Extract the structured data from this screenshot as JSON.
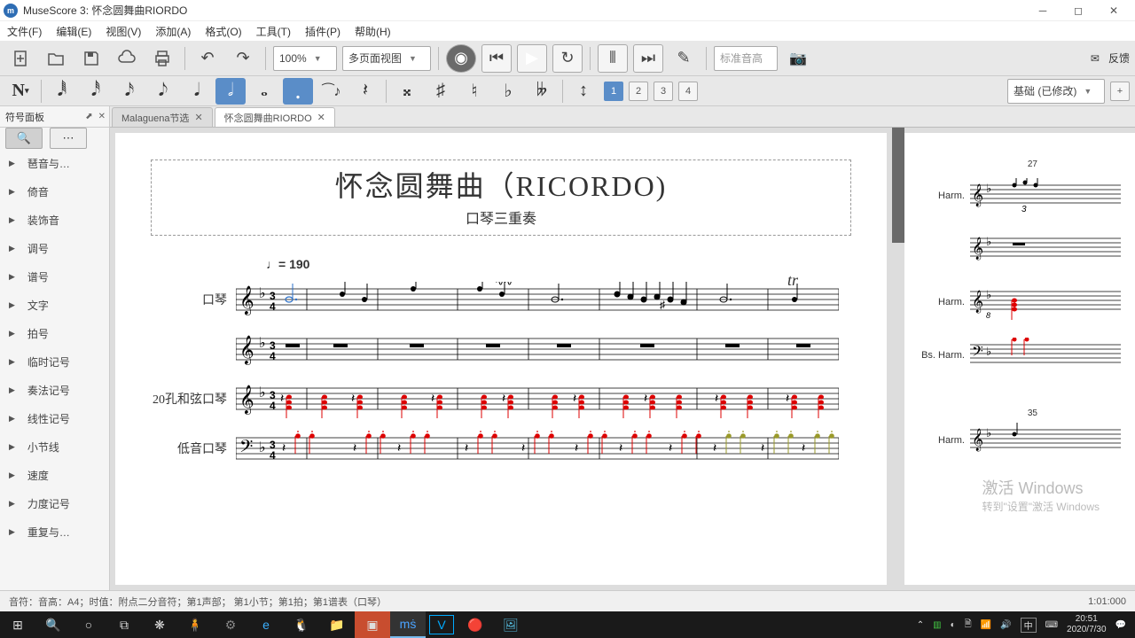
{
  "window": {
    "title": "MuseScore 3: 怀念圆舞曲RIORDO"
  },
  "menu": [
    "文件(F)",
    "编辑(E)",
    "视图(V)",
    "添加(A)",
    "格式(O)",
    "工具(T)",
    "插件(P)",
    "帮助(H)"
  ],
  "toolbar1": {
    "zoom": "100%",
    "view_mode": "多页面视图",
    "tuning": "标准音高",
    "feedback": "反馈"
  },
  "toolbar2": {
    "voices": [
      "1",
      "2",
      "3",
      "4"
    ],
    "active_voice": 0,
    "workspace": "基础 (已修改)"
  },
  "sidepanel": {
    "title": "符号面板",
    "items": [
      "琶音与…",
      "倚音",
      "装饰音",
      "调号",
      "谱号",
      "文字",
      "拍号",
      "临时记号",
      "奏法记号",
      "线性记号",
      "小节线",
      "速度",
      "力度记号",
      "重复与…"
    ]
  },
  "tabs": [
    {
      "label": "Malaguena节选",
      "active": false
    },
    {
      "label": "怀念圆舞曲RIORDO",
      "active": true
    }
  ],
  "score": {
    "title": "怀念圆舞曲（RICORDO)",
    "subtitle": "口琴三重奏",
    "tempo": "♩= 190",
    "instruments": [
      "口琴",
      "",
      "20孔和弦口琴",
      "低音口琴"
    ],
    "page2_labels": [
      "Harm.",
      "Harm.",
      "Bs. Harm.",
      "Harm."
    ],
    "measure27": "27",
    "measure35": "35"
  },
  "status": {
    "text": "音符：音高：A4；时值：附点二分音符；第1声部；   第1小节；第1拍；第1谱表（口琴）",
    "time": "1:01:000"
  },
  "watermark": {
    "line1": "激活 Windows",
    "line2": "转到\"设置\"激活 Windows"
  },
  "taskbar": {
    "clock": "20:51",
    "date": "2020/7/30",
    "ime": "中"
  }
}
